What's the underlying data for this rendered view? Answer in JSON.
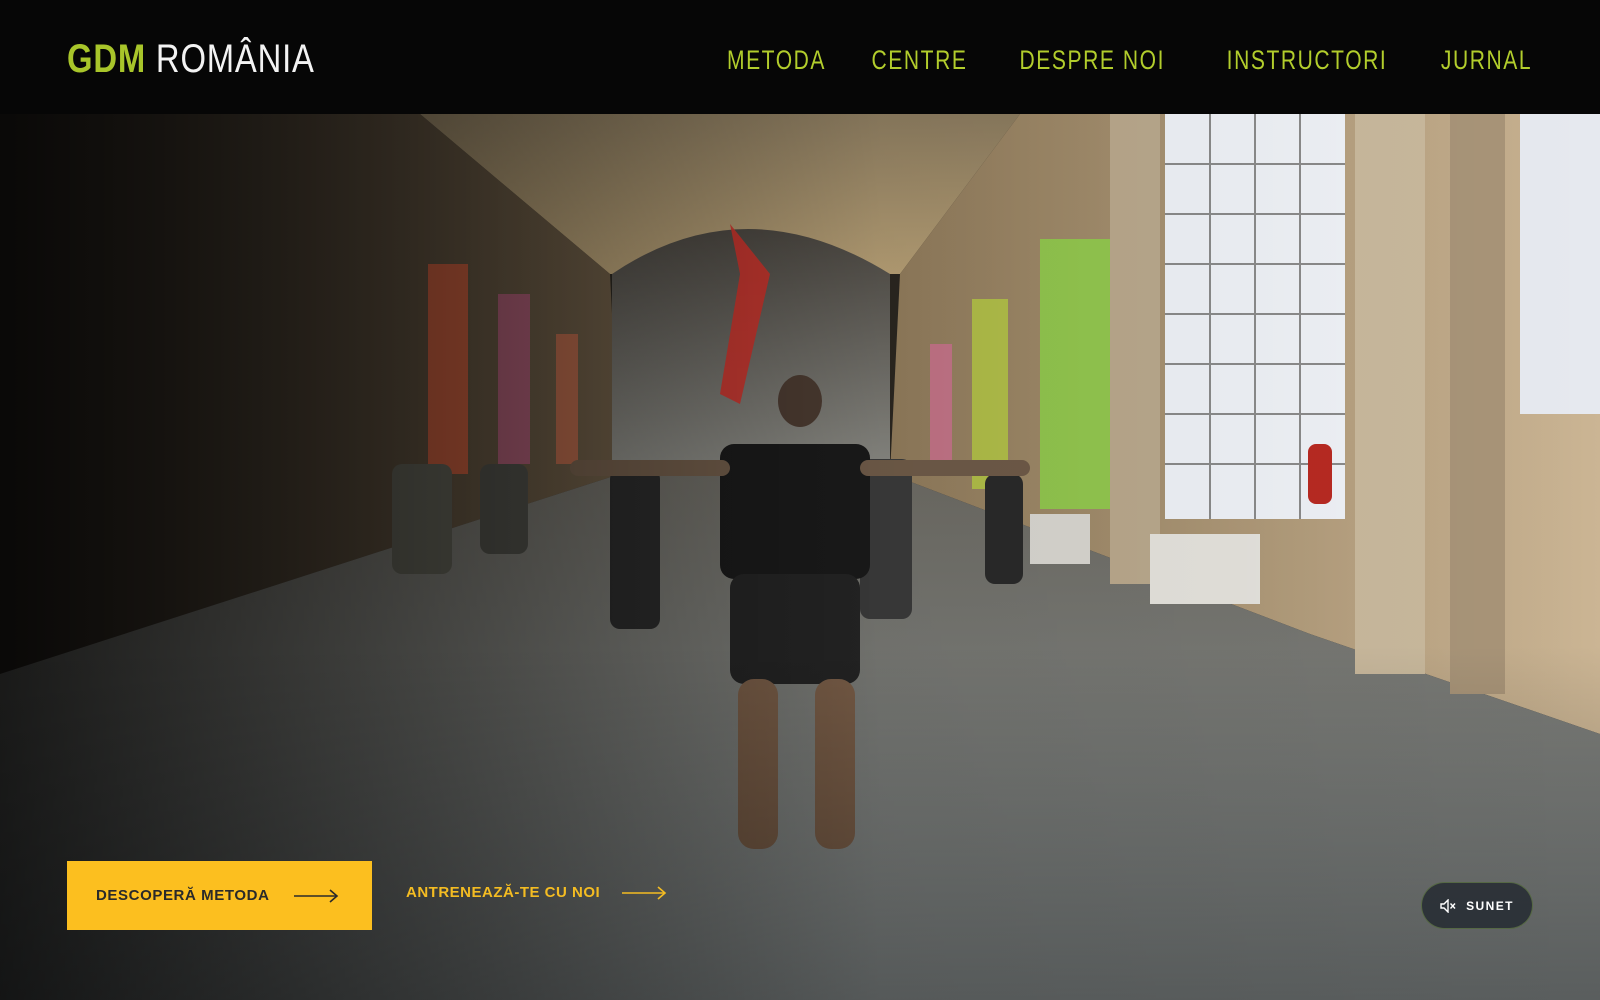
{
  "header": {
    "logo_part1": "GDM",
    "logo_part2": "ROMÂNIA",
    "nav": [
      "METODA",
      "CENTRE",
      "DESPRE NOI",
      "INSTRUCTORI",
      "JURNAL"
    ]
  },
  "hero": {
    "primary_cta": "DESCOPERĂ METODA",
    "secondary_cta": "ANTRENEAZĂ-TE CU NOI",
    "sound_label": "SUNET"
  },
  "colors": {
    "accent_green": "#b2cd2c",
    "cta_yellow": "#fcbf1f",
    "header_bg": "#060606"
  },
  "icons": {
    "arrow": "arrow-right-icon",
    "sound": "speaker-muted-icon"
  }
}
